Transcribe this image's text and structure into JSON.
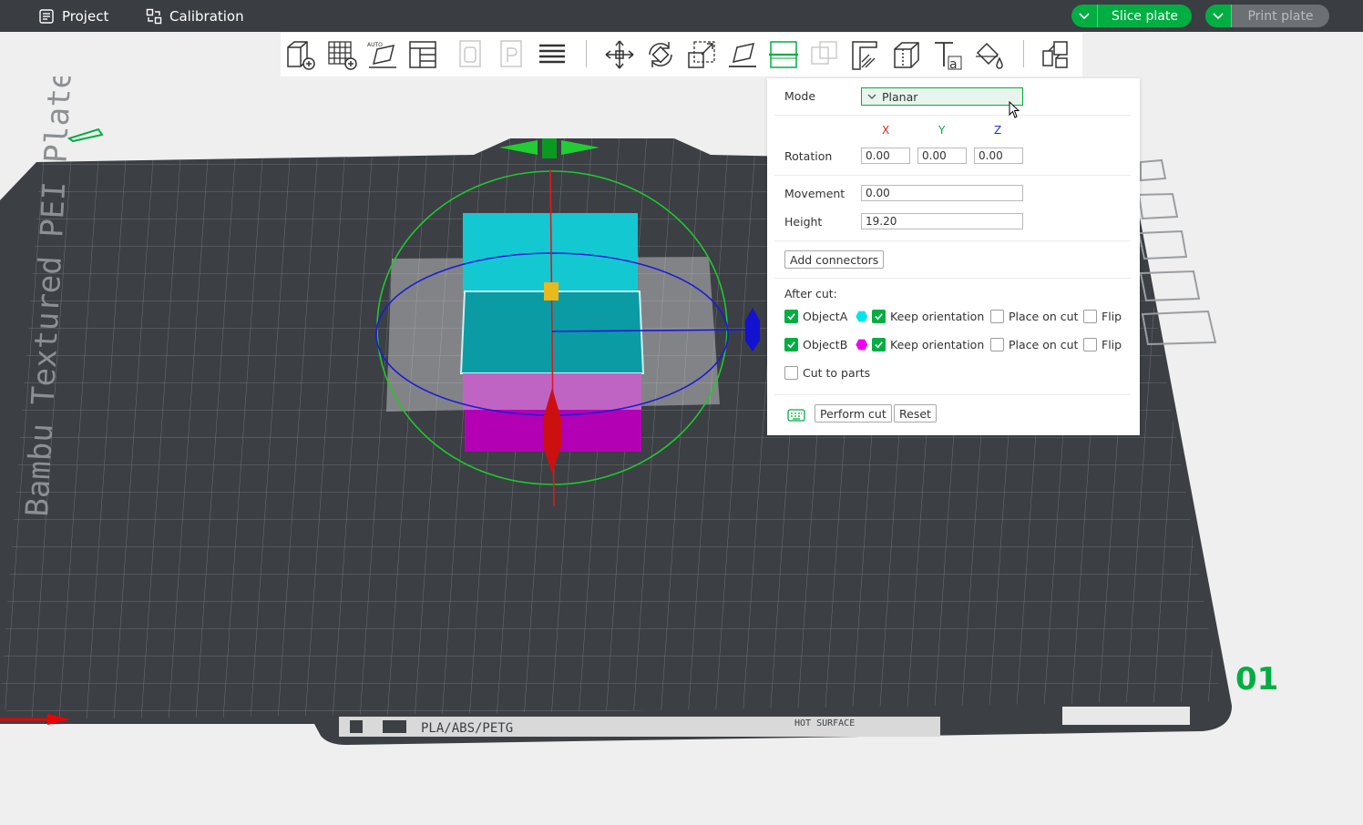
{
  "topbar": {
    "project_label": "Project",
    "calibration_label": "Calibration",
    "slice_label": "Slice plate",
    "print_label": "Print plate"
  },
  "toolbar": {
    "tools": [
      "add-object",
      "arrange-grid",
      "auto-orient",
      "layout-panels",
      "copy-plate",
      "paste-plate",
      "layers",
      "move",
      "rotate",
      "scale",
      "lay-on-face",
      "cut",
      "boolean",
      "support-painting",
      "seam-painting",
      "text",
      "color-painting",
      "assembly"
    ]
  },
  "viewport": {
    "plate_name": "Bambu Textured PEI Plate",
    "plate_materials": "PLA/ABS/PETG",
    "hot_surface": "HOT SURFACE",
    "plate_number": "01"
  },
  "cut_panel": {
    "mode_label": "Mode",
    "mode_value": "Planar",
    "axis_x": "X",
    "axis_y": "Y",
    "axis_z": "Z",
    "rotation_label": "Rotation",
    "rotation_x": "0.00",
    "rotation_y": "0.00",
    "rotation_z": "0.00",
    "movement_label": "Movement",
    "movement_value": "0.00",
    "height_label": "Height",
    "height_value": "19.20",
    "add_connectors_label": "Add connectors",
    "after_cut_label": "After cut:",
    "object_a": {
      "label": "ObjectA",
      "color": "#00e5ee",
      "checked": true,
      "keep_orientation": true,
      "place_on_cut": false,
      "flip": false
    },
    "object_b": {
      "label": "ObjectB",
      "color": "#f000f0",
      "checked": true,
      "keep_orientation": true,
      "place_on_cut": false,
      "flip": false
    },
    "keep_orientation_label": "Keep orientation",
    "place_on_cut_label": "Place on cut",
    "flip_label": "Flip",
    "cut_to_parts_label": "Cut to parts",
    "cut_to_parts_checked": false,
    "perform_cut_label": "Perform cut",
    "reset_label": "Reset"
  },
  "colors": {
    "accent": "#00ae42",
    "topbar": "#3a3d42",
    "plate": "#3c3f44",
    "object_a_top": "#14c8d2",
    "object_b": "#b400b4"
  }
}
